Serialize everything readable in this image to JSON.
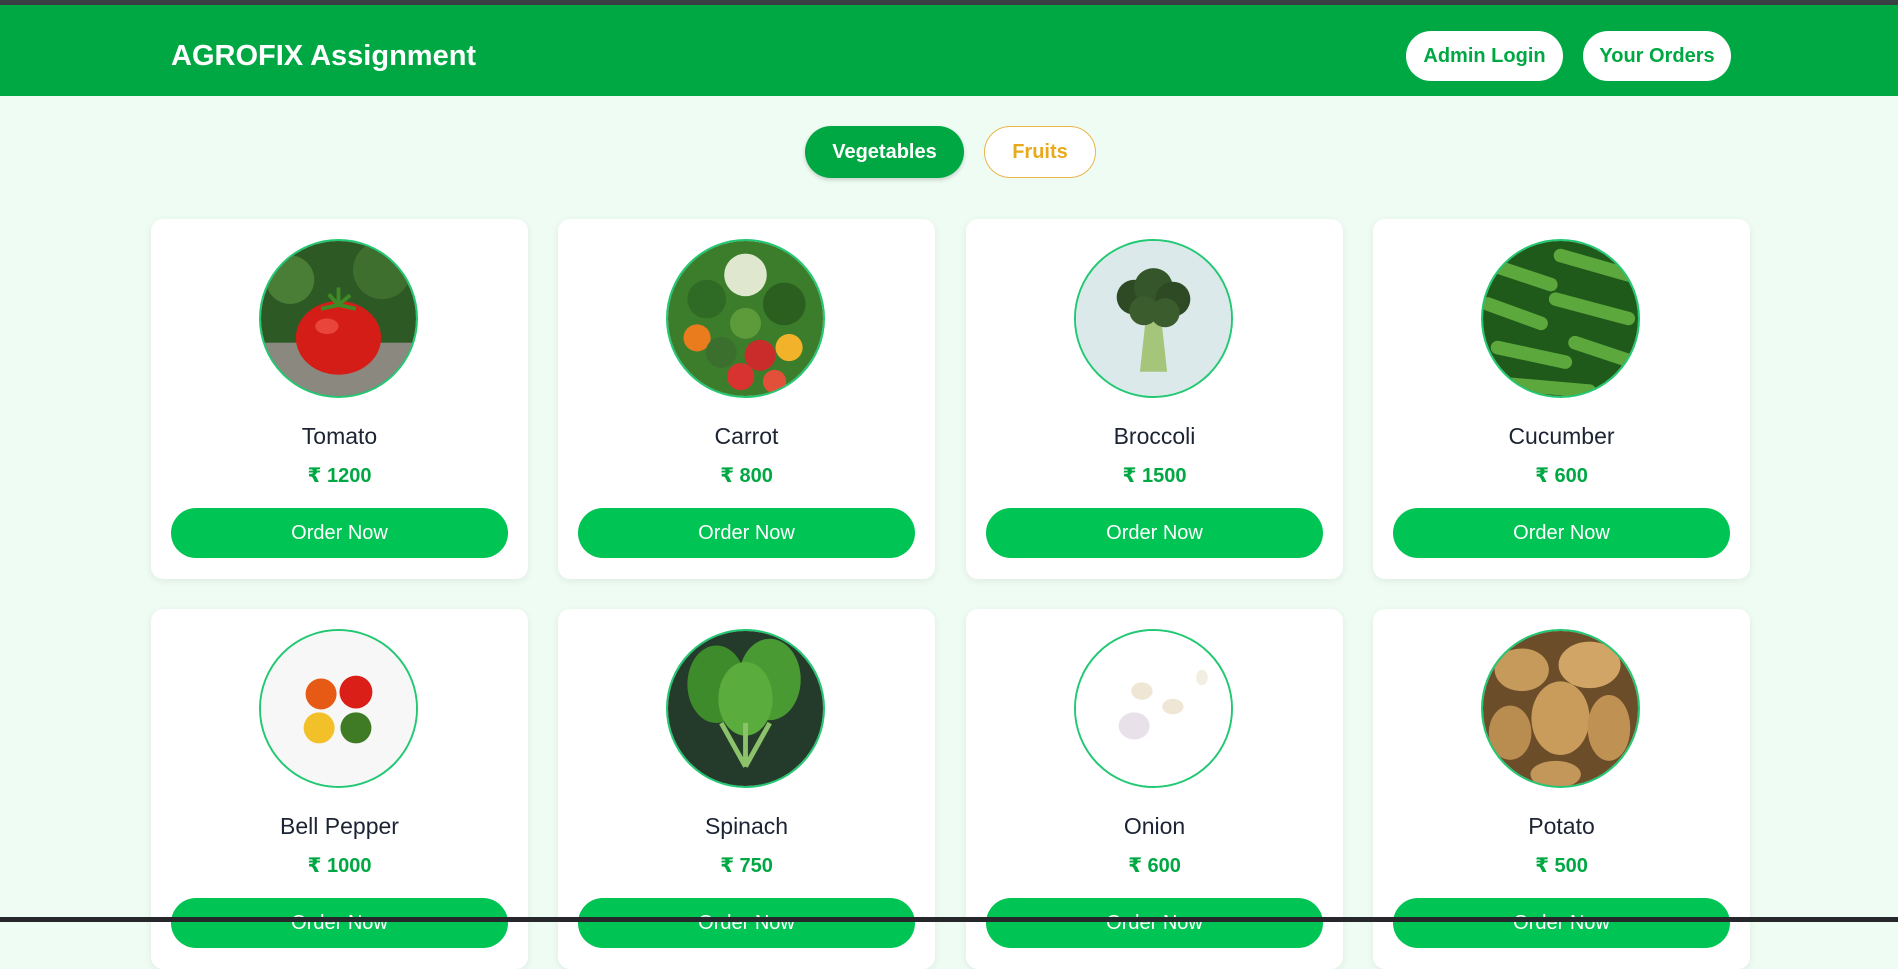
{
  "header": {
    "brand": "AGROFIX Assignment",
    "admin_login": "Admin Login",
    "your_orders": "Your Orders"
  },
  "tabs": {
    "vegetables": "Vegetables",
    "fruits": "Fruits",
    "active": "Vegetables"
  },
  "products": [
    {
      "name": "Tomato",
      "price": "₹ 1200",
      "button": "Order Now"
    },
    {
      "name": "Carrot",
      "price": "₹ 800",
      "button": "Order Now"
    },
    {
      "name": "Broccoli",
      "price": "₹ 1500",
      "button": "Order Now"
    },
    {
      "name": "Cucumber",
      "price": "₹ 600",
      "button": "Order Now"
    },
    {
      "name": "Bell Pepper",
      "price": "₹ 1000",
      "button": "Order Now"
    },
    {
      "name": "Spinach",
      "price": "₹ 750",
      "button": "Order Now"
    },
    {
      "name": "Onion",
      "price": "₹ 600",
      "button": "Order Now"
    },
    {
      "name": "Potato",
      "price": "₹ 500",
      "button": "Order Now"
    }
  ],
  "colors": {
    "brand_green": "#00a843",
    "button_green": "#00c453",
    "page_bg": "#eefcf3",
    "fruits_accent": "#e9a91c"
  }
}
